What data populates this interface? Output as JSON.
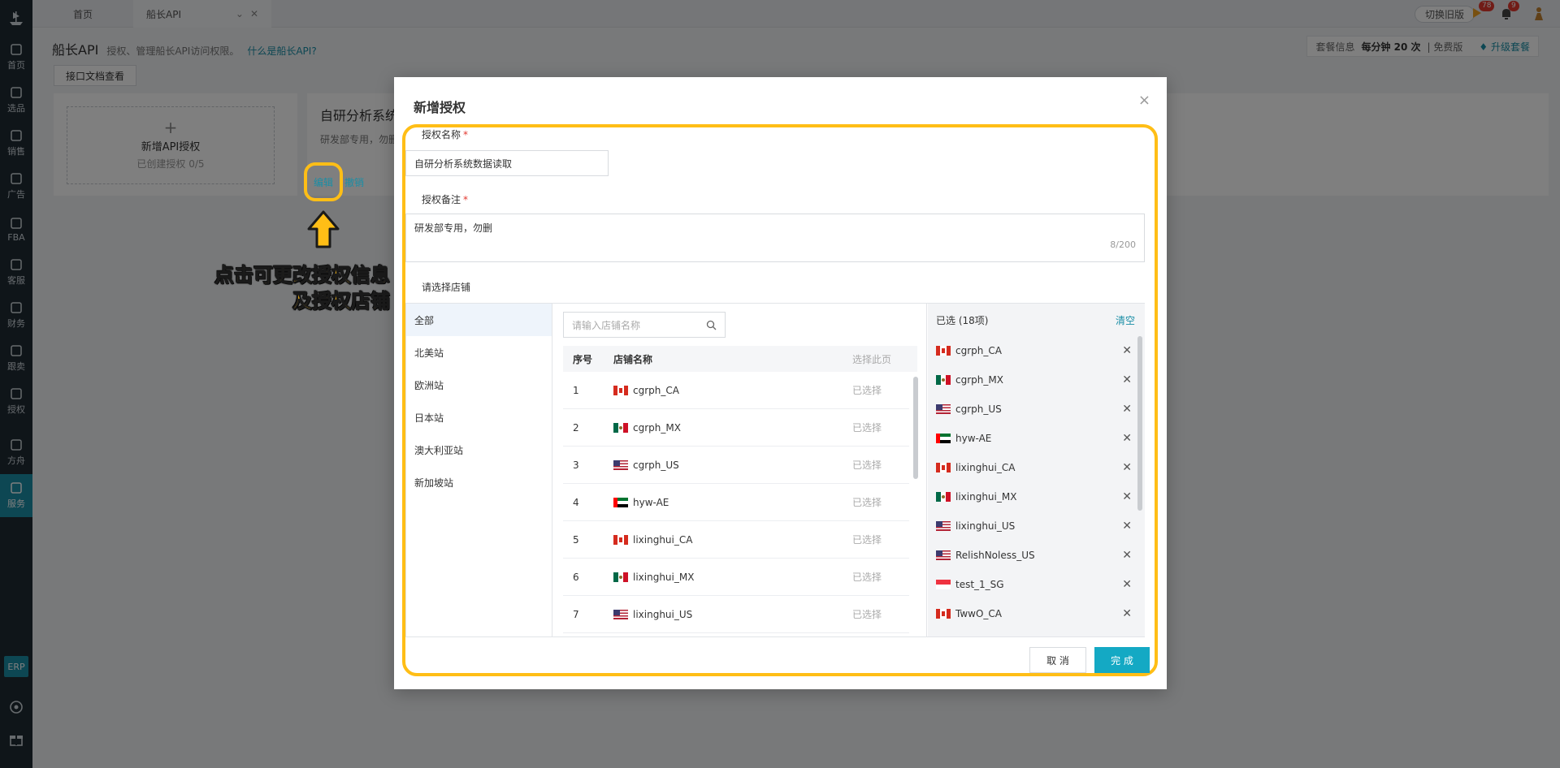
{
  "tabs": {
    "home": "首页",
    "current": "船长API"
  },
  "topbar": {
    "switch_old": "切换旧版",
    "flag_count": "78",
    "bell_count": "9"
  },
  "sidebar": {
    "items": [
      "首页",
      "选品",
      "销售",
      "广告",
      "FBA",
      "客服",
      "财务",
      "跟卖",
      "授权",
      "方舟",
      "服务"
    ],
    "erp": "ERP"
  },
  "page": {
    "title": "船长API",
    "desc": "授权、管理船长API访问权限。",
    "link": "什么是船长API?",
    "plan_label": "套餐信息",
    "plan_value": "每分钟 20 次",
    "plan_type": "| 免费版",
    "upgrade": "升级套餐",
    "doc_button": "接口文档查看",
    "add_card": {
      "plus": "+",
      "title": "新增API授权",
      "sub": "已创建授权 0/5"
    },
    "auth_card": {
      "name": "自研分析系统数",
      "note": "研发部专用，勿删",
      "edit": "编辑",
      "revoke": "撤销"
    }
  },
  "callout": {
    "line1": "点击可更改授权信息",
    "line2": "及授权店铺"
  },
  "modal": {
    "title": "新增授权",
    "name_label": "授权名称",
    "name_value": "自研分析系统数据读取",
    "note_label": "授权备注",
    "note_value": "研发部专用，勿删",
    "note_count": "8/200",
    "shop_label": "请选择店铺",
    "regions": [
      "全部",
      "北美站",
      "欧洲站",
      "日本站",
      "澳大利亚站",
      "新加坡站"
    ],
    "search_placeholder": "请输入店铺名称",
    "columns": {
      "index": "序号",
      "name": "店铺名称",
      "select_page": "选择此页"
    },
    "rows": [
      {
        "index": "1",
        "name": "cgrph_CA",
        "flag": "CA",
        "status": "已选择"
      },
      {
        "index": "2",
        "name": "cgrph_MX",
        "flag": "MX",
        "status": "已选择"
      },
      {
        "index": "3",
        "name": "cgrph_US",
        "flag": "US",
        "status": "已选择"
      },
      {
        "index": "4",
        "name": "hyw-AE",
        "flag": "AE",
        "status": "已选择"
      },
      {
        "index": "5",
        "name": "lixinghui_CA",
        "flag": "CA",
        "status": "已选择"
      },
      {
        "index": "6",
        "name": "lixinghui_MX",
        "flag": "MX",
        "status": "已选择"
      },
      {
        "index": "7",
        "name": "lixinghui_US",
        "flag": "US",
        "status": "已选择"
      }
    ],
    "selected_title": "已选 (18项)",
    "clear": "清空",
    "selected": [
      {
        "name": "cgrph_CA",
        "flag": "CA"
      },
      {
        "name": "cgrph_MX",
        "flag": "MX"
      },
      {
        "name": "cgrph_US",
        "flag": "US"
      },
      {
        "name": "hyw-AE",
        "flag": "AE"
      },
      {
        "name": "lixinghui_CA",
        "flag": "CA"
      },
      {
        "name": "lixinghui_MX",
        "flag": "MX"
      },
      {
        "name": "lixinghui_US",
        "flag": "US"
      },
      {
        "name": "RelishNoless_US",
        "flag": "US"
      },
      {
        "name": "test_1_SG",
        "flag": "SG"
      },
      {
        "name": "TwwO_CA",
        "flag": "CA"
      }
    ],
    "cancel": "取 消",
    "ok": "完 成",
    "close": "×"
  },
  "colors": {
    "accent": "#1a8ea6",
    "primary_button": "#14a9c4",
    "highlight": "#ffbe16"
  }
}
